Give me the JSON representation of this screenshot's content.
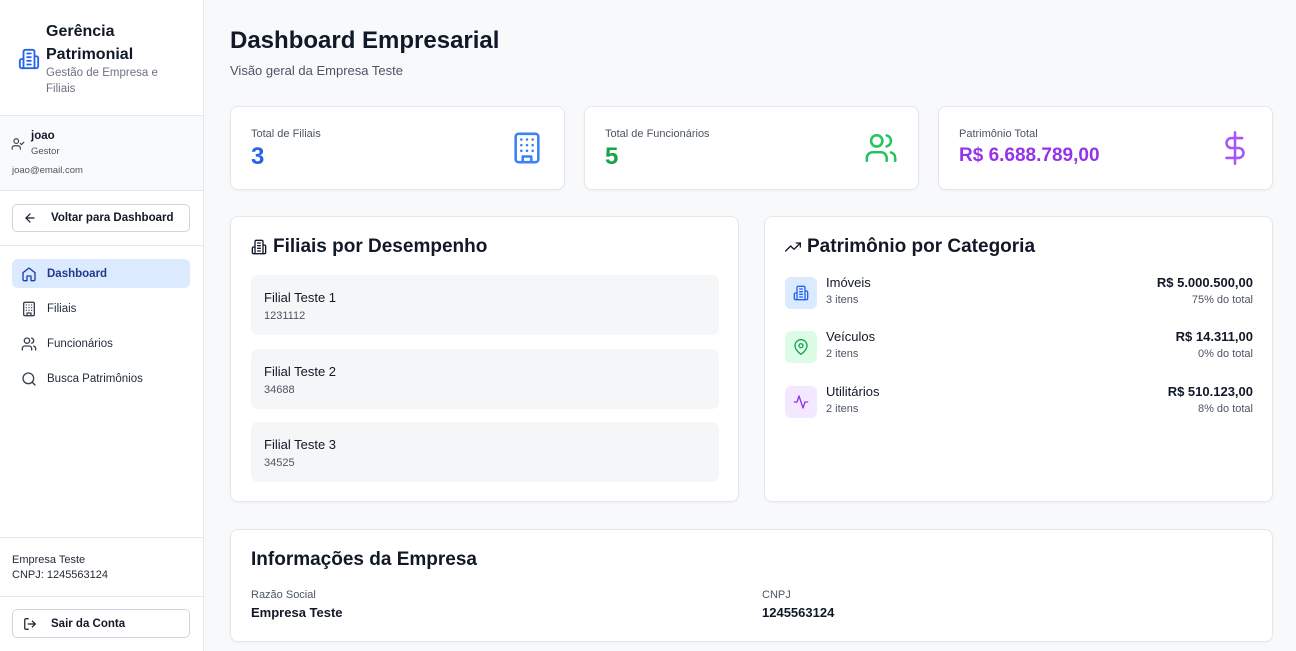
{
  "sidebar": {
    "brand_title": "Gerência Patrimonial",
    "brand_subtitle": "Gestão de Empresa e Filiais",
    "user": {
      "name": "joao",
      "role": "Gestor",
      "email": "joao@email.com"
    },
    "back_label": "Voltar para Dashboard",
    "nav": [
      {
        "label": "Dashboard",
        "icon": "home-icon",
        "active": true
      },
      {
        "label": "Filiais",
        "icon": "building-icon",
        "active": false
      },
      {
        "label": "Funcionários",
        "icon": "users-icon",
        "active": false
      },
      {
        "label": "Busca Patrimônios",
        "icon": "search-icon",
        "active": false
      }
    ],
    "company_name": "Empresa Teste",
    "company_cnpj": "CNPJ: 1245563124",
    "logout_label": "Sair da Conta"
  },
  "header": {
    "title": "Dashboard Empresarial",
    "subtitle": "Visão geral da Empresa Teste"
  },
  "stats": [
    {
      "label": "Total de Filiais",
      "value": "3",
      "color": "#2563eb",
      "icon": "building-icon"
    },
    {
      "label": "Total de Funcionários",
      "value": "5",
      "color": "#16a34a",
      "icon": "users-icon"
    },
    {
      "label": "Patrimônio Total",
      "value": "R$ 6.688.789,00",
      "color": "#9333ea",
      "icon": "dollar-icon"
    }
  ],
  "branches": {
    "title": "Filiais por Desempenho",
    "items": [
      {
        "name": "Filial Teste 1",
        "code": "1231112"
      },
      {
        "name": "Filial Teste 2",
        "code": "34688"
      },
      {
        "name": "Filial Teste 3",
        "code": "34525"
      }
    ]
  },
  "categories": {
    "title": "Patrimônio por Categoria",
    "items": [
      {
        "name": "Imóveis",
        "count": "3 itens",
        "value": "R$ 5.000.500,00",
        "percent": "75% do total",
        "icon": "building-icon",
        "color": "#2563eb",
        "bg": "#dbeafe"
      },
      {
        "name": "Veículos",
        "count": "2 itens",
        "value": "R$ 14.311,00",
        "percent": "0% do total",
        "icon": "map-pin-icon",
        "color": "#16a34a",
        "bg": "#dcfce7"
      },
      {
        "name": "Utilitários",
        "count": "2 itens",
        "value": "R$ 510.123,00",
        "percent": "8% do total",
        "icon": "activity-icon",
        "color": "#9333ea",
        "bg": "#f3e8ff"
      }
    ]
  },
  "company_info": {
    "title": "Informações da Empresa",
    "razao_label": "Razão Social",
    "razao_value": "Empresa Teste",
    "cnpj_label": "CNPJ",
    "cnpj_value": "1245563124"
  }
}
